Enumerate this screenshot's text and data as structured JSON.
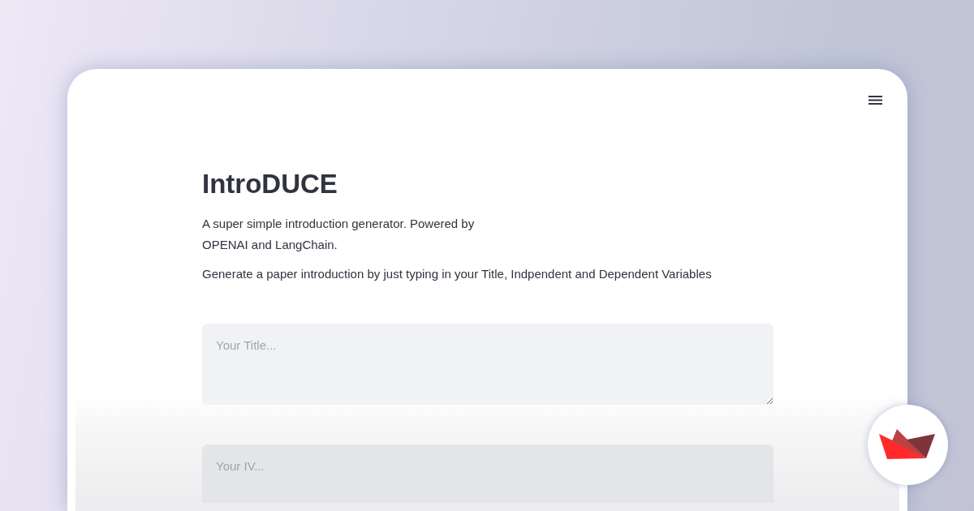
{
  "app": {
    "title": "IntroDUCE",
    "description": [
      "A super simple introduction generator. Powered by",
      "OPENAI and LangChain."
    ],
    "instruction": "Generate a paper introduction by just typing in your Title, Indpendent and Dependent Variables"
  },
  "fields": [
    {
      "placeholder": "Your Title..."
    },
    {
      "placeholder": "Your IV..."
    }
  ]
}
